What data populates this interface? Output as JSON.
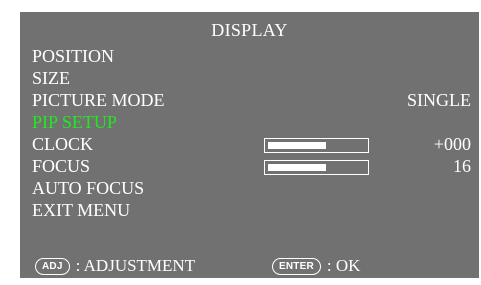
{
  "menu": {
    "title": "DISPLAY",
    "items": [
      {
        "label": "POSITION"
      },
      {
        "label": "SIZE"
      },
      {
        "label": "PICTURE MODE",
        "value": "SINGLE"
      },
      {
        "label": "PIP SETUP",
        "active": true
      },
      {
        "label": "CLOCK",
        "value": "+000",
        "bar_level": 0.6
      },
      {
        "label": "FOCUS",
        "value": "16",
        "bar_level": 0.6
      },
      {
        "label": "AUTO FOCUS"
      },
      {
        "label": "EXIT MENU"
      }
    ]
  },
  "footer": {
    "adj_key": "ADJ",
    "adj_label": ": ADJUSTMENT",
    "enter_key": "ENTER",
    "enter_label": ": OK"
  },
  "colors": {
    "background": "#717171",
    "text": "#ffffff",
    "highlight": "#22e822"
  }
}
